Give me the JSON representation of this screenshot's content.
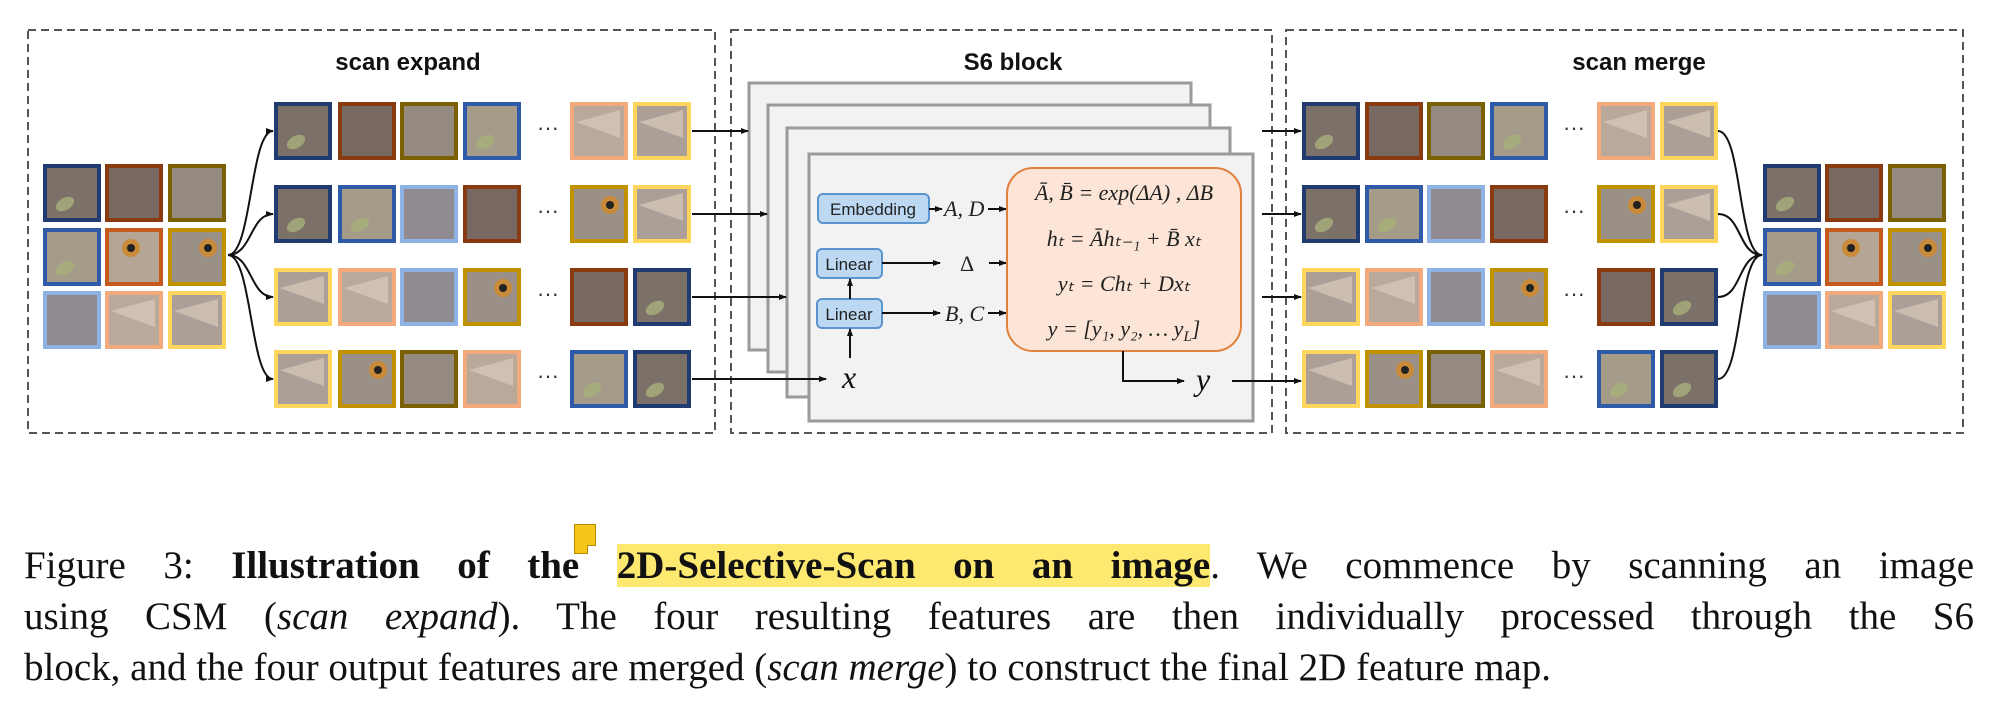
{
  "figure": {
    "scan_expand": {
      "title": "scan expand"
    },
    "s6_block": {
      "title": "S6 block",
      "embedding_label": "Embedding",
      "linear1_label": "Linear",
      "linear2_label": "Linear",
      "ad_label": "A, D",
      "delta_label": "Δ",
      "bc_label": "B, C",
      "input_label": "x",
      "output_label": "y",
      "equations": {
        "eq1": "Ā, B̄ = exp(ΔA) , ΔB",
        "eq2": "hₜ = Āhₜ₋₁ + B̄ xₜ",
        "eq3": "yₜ = Chₜ + Dxₜ",
        "eq4_main": "y = [y₁, y₂, … y",
        "eq4_sub": "L",
        "eq4_end": "]"
      }
    },
    "scan_merge": {
      "title": "scan merge"
    },
    "ellipsis": "···",
    "patch_border_colors": [
      "#1f3b70",
      "#8a3a10",
      "#7a6000",
      "#2f5aa8",
      "#c65a1c",
      "#c09200",
      "#8fb2e4",
      "#f2a97c",
      "#ffd65c"
    ],
    "patch_fill_colors": [
      "#7c7168",
      "#776862",
      "#958a80",
      "#a49b88",
      "#b5a595",
      "#9a9088",
      "#8f8b90",
      "#baa99b",
      "#ab9f98"
    ],
    "grid": [
      [
        0,
        1,
        2
      ],
      [
        3,
        4,
        5
      ],
      [
        6,
        7,
        8
      ]
    ],
    "scan_sequences": [
      {
        "head": [
          0,
          1,
          2,
          3
        ],
        "tail": [
          7,
          8
        ]
      },
      {
        "head": [
          0,
          3,
          6,
          1
        ],
        "tail": [
          5,
          8
        ]
      },
      {
        "head": [
          8,
          7,
          6,
          5
        ],
        "tail": [
          1,
          0
        ]
      },
      {
        "head": [
          8,
          5,
          2,
          7
        ],
        "tail": [
          3,
          0
        ]
      }
    ],
    "s6_box_fill": "#fce5d6",
    "s6_box_stroke": "#e0803e",
    "button_fill": "#bcd8f2",
    "button_stroke": "#5b95d0"
  },
  "caption": {
    "label": "Figure 3:",
    "bold_pre": "Illustration of the",
    "bold_highlight": "2D-Selective-Scan on an image",
    "line1_rest": ". We commence by scanning an image",
    "line2_a": "using CSM (",
    "line2_italic": "scan expand",
    "line2_b": "). The four resulting features are then individually processed through the S6",
    "line3_a": "block, and the four output features are merged (",
    "line3_italic": "scan merge",
    "line3_b": ") to construct the final 2D feature map.",
    "highlight_color": "#fde870"
  }
}
